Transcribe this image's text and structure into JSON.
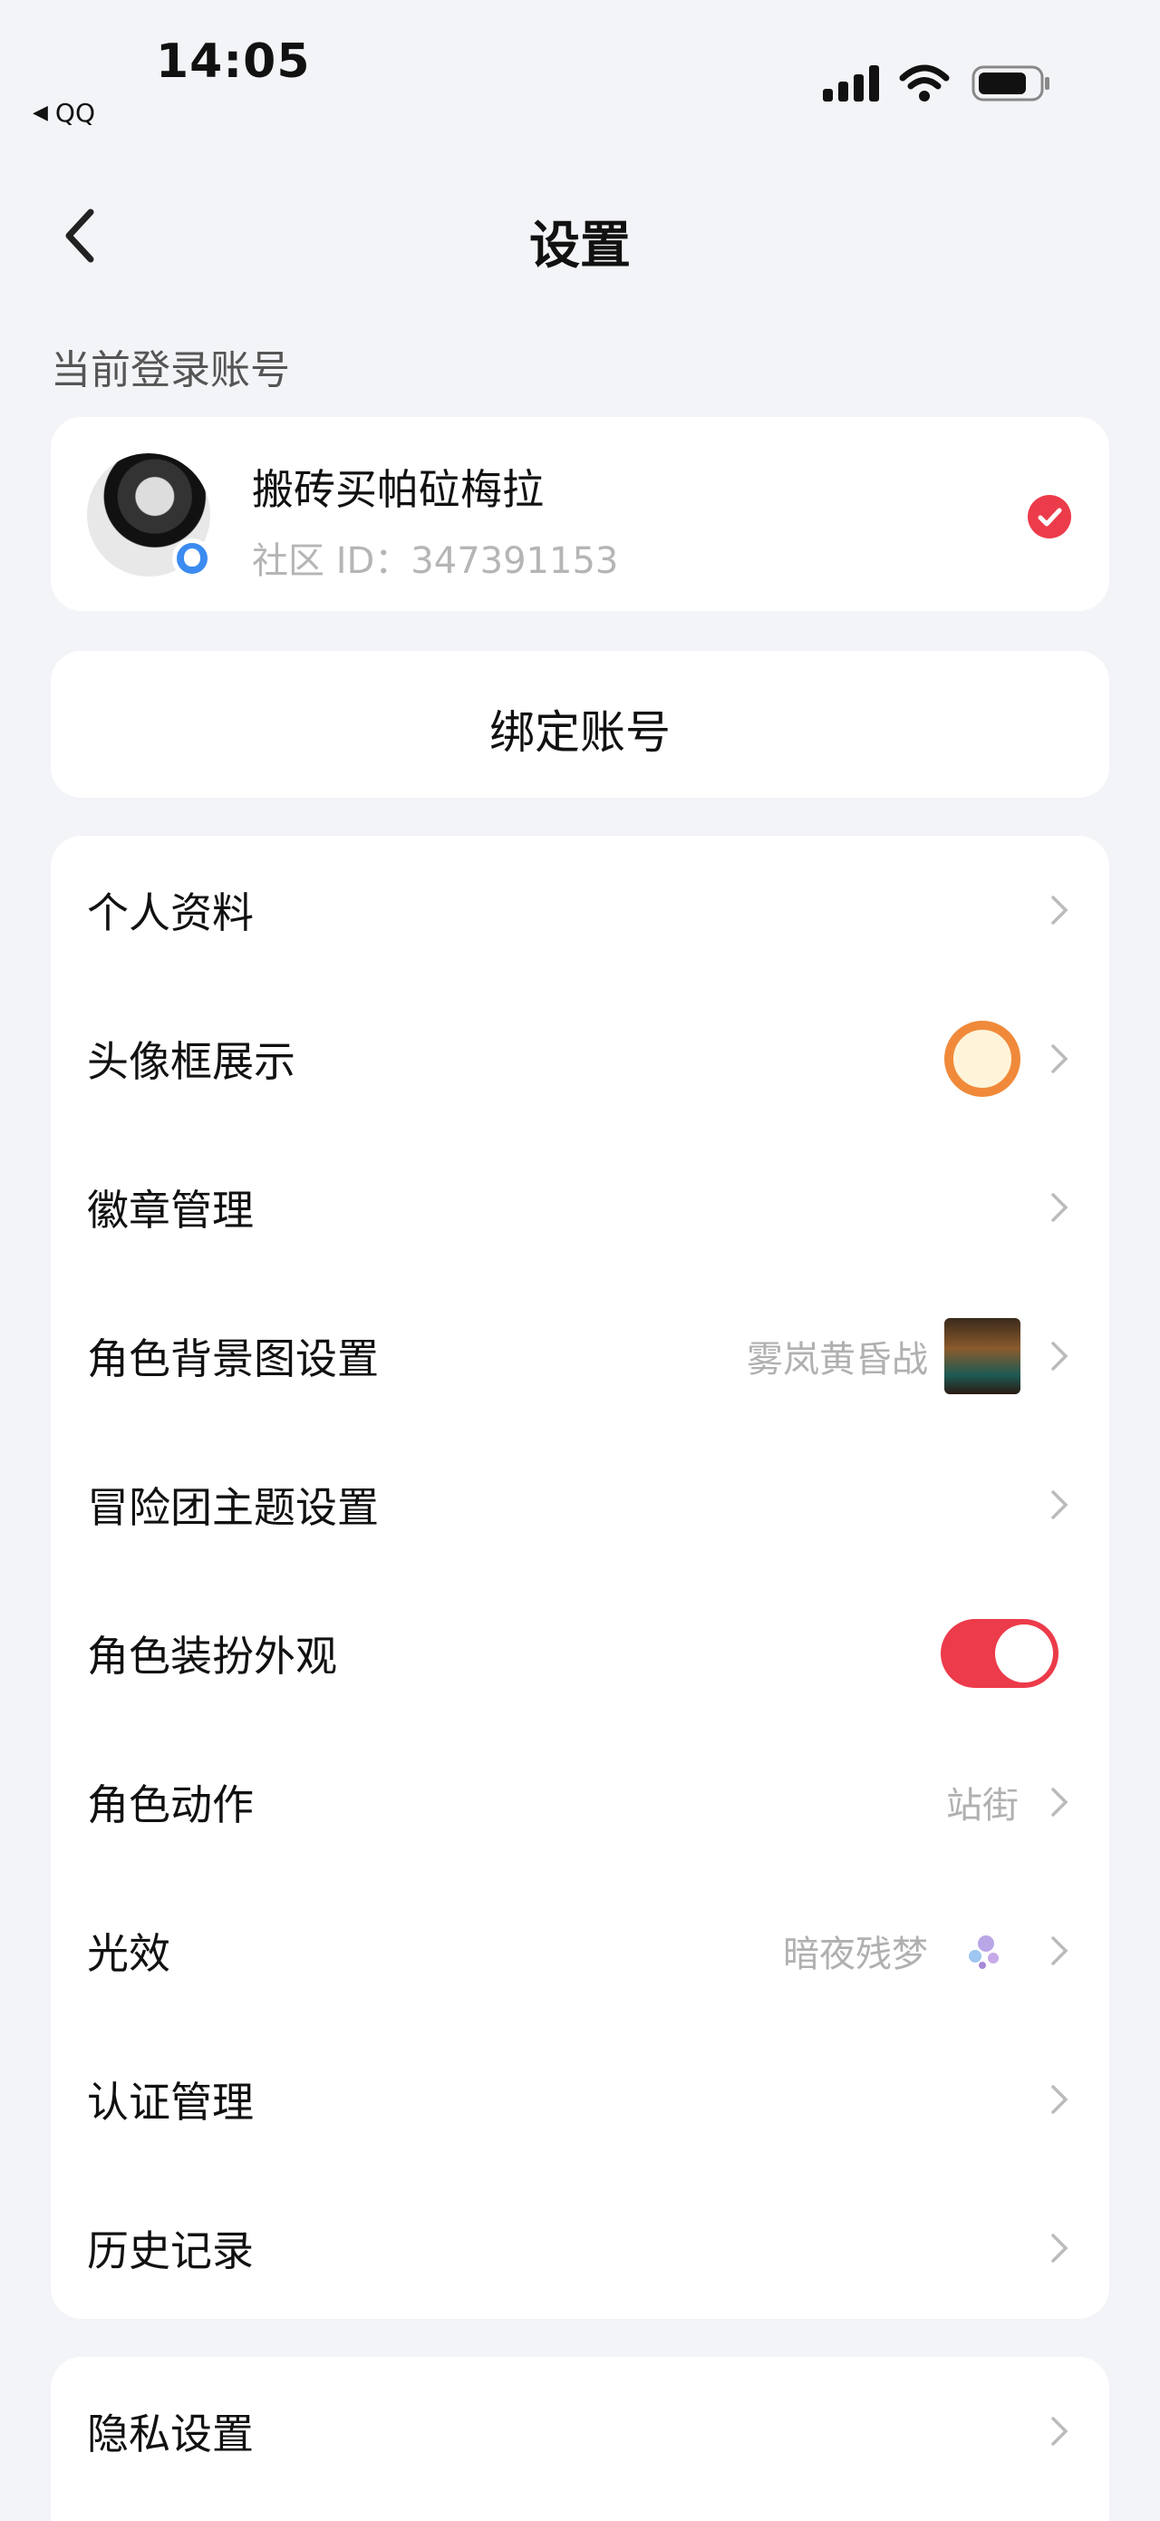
{
  "status_bar": {
    "time": "14:05",
    "back_app": "QQ"
  },
  "nav": {
    "title": "设置"
  },
  "account_section": {
    "label": "当前登录账号",
    "name": "搬砖买帕砬梅拉",
    "id_text": "社区 ID：347391153"
  },
  "bind": {
    "label": "绑定账号"
  },
  "menu": {
    "items": [
      {
        "label": "个人资料"
      },
      {
        "label": "头像框展示"
      },
      {
        "label": "徽章管理"
      },
      {
        "label": "角色背景图设置",
        "value": "雾岚黄昏战"
      },
      {
        "label": "冒险团主题设置"
      },
      {
        "label": "角色装扮外观",
        "toggle": true
      },
      {
        "label": "角色动作",
        "value": "站街"
      },
      {
        "label": "光效",
        "value": "暗夜残梦"
      },
      {
        "label": "认证管理"
      },
      {
        "label": "历史记录"
      }
    ]
  },
  "privacy": {
    "label": "隐私设置"
  },
  "colors": {
    "accent": "#ec3b4a",
    "background": "#f3f4f7",
    "badge": "#3b8bf0"
  }
}
